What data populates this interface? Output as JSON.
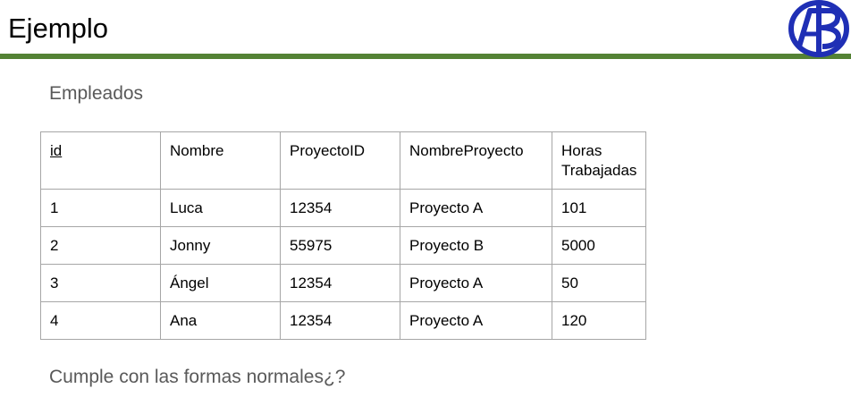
{
  "slide": {
    "title": "Ejemplo",
    "accent_color": "#548235",
    "logo_color": "#1f2fb5",
    "logo_text": "ALB"
  },
  "section": {
    "heading": "Empleados"
  },
  "table": {
    "headers": [
      "id",
      "Nombre",
      "ProyectoID",
      "NombreProyecto",
      "Horas Trabajadas"
    ],
    "rows": [
      [
        "1",
        "Luca",
        "12354",
        "Proyecto A",
        "101"
      ],
      [
        "2",
        "Jonny",
        "55975",
        "Proyecto B",
        "5000"
      ],
      [
        "3",
        "Ángel",
        "12354",
        "Proyecto A",
        "50"
      ],
      [
        "4",
        "Ana",
        "12354",
        "Proyecto A",
        "120"
      ]
    ]
  },
  "footer": {
    "question": "Cumple con las formas normales¿?"
  }
}
